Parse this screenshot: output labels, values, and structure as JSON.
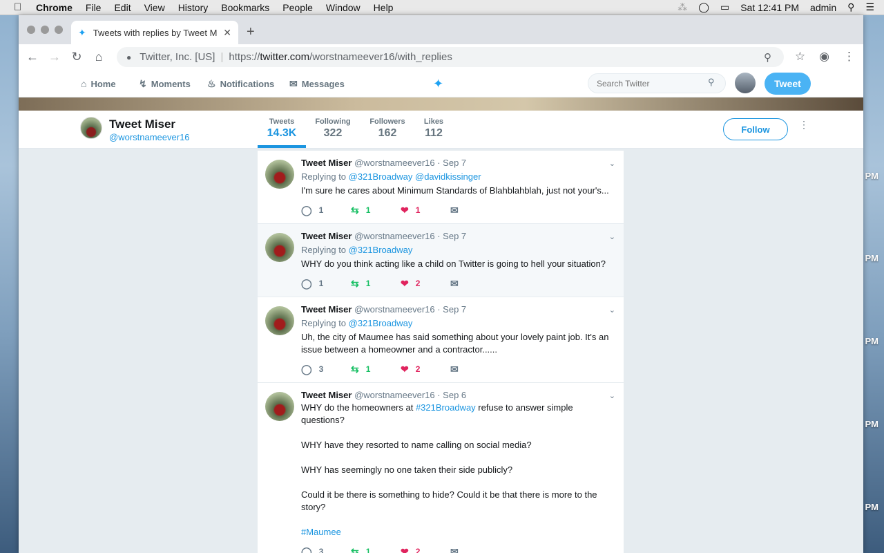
{
  "menubar": {
    "app": "Chrome",
    "items": [
      "File",
      "Edit",
      "View",
      "History",
      "Bookmarks",
      "People",
      "Window",
      "Help"
    ],
    "clock": "Sat 12:41 PM",
    "user": "admin"
  },
  "desktop": {
    "pm_labels": [
      "PM",
      "PM",
      "PM",
      "PM",
      "PM"
    ]
  },
  "browser": {
    "tab_title": "Tweets with replies by Tweet M",
    "org": "Twitter, Inc. [US]",
    "url_prefix": "https://",
    "url_host": "twitter.com",
    "url_path": "/worstnameever16/with_replies"
  },
  "twitter_nav": {
    "home": "Home",
    "moments": "Moments",
    "notifications": "Notifications",
    "messages": "Messages",
    "search_placeholder": "Search Twitter",
    "tweet_button": "Tweet"
  },
  "profile": {
    "name": "Tweet Miser",
    "handle": "@worstnameever16",
    "stats": [
      {
        "label": "Tweets",
        "value": "14.3K"
      },
      {
        "label": "Following",
        "value": "322"
      },
      {
        "label": "Followers",
        "value": "162"
      },
      {
        "label": "Likes",
        "value": "112"
      }
    ],
    "follow_label": "Follow"
  },
  "tweets": [
    {
      "name": "Tweet Miser",
      "handle": "@worstnameever16",
      "date": "· Sep 7",
      "replying_prefix": "Replying to",
      "reply_to_1": "@321Broadway",
      "reply_to_2": "@davidkissinger",
      "text": "I'm sure he cares about Minimum Standards of Blahblahblah, just not your's...",
      "replies": "1",
      "retweets": "1",
      "likes": "1"
    },
    {
      "name": "Tweet Miser",
      "handle": "@worstnameever16",
      "date": "· Sep 7",
      "replying_prefix": "Replying to",
      "reply_to_1": "@321Broadway",
      "text": "WHY do you think acting like a child on Twitter is going to hell your situation?",
      "replies": "1",
      "retweets": "1",
      "likes": "2"
    },
    {
      "name": "Tweet Miser",
      "handle": "@worstnameever16",
      "date": "· Sep 7",
      "replying_prefix": "Replying to",
      "reply_to_1": "@321Broadway",
      "text": "Uh, the city of Maumee has said something about your lovely paint job. It's an issue between a homeowner and a contractor......",
      "replies": "3",
      "retweets": "1",
      "likes": "2"
    },
    {
      "name": "Tweet Miser",
      "handle": "@worstnameever16",
      "date": "· Sep 6",
      "text_before_tag": "WHY do the homeowners at ",
      "hashtag_1": "#321Broadway",
      "text_after_tag": " refuse to answer simple questions?\n\nWHY have they resorted to name calling on social media?\n\nWHY has seemingly no one taken their side publicly?\n\nCould it be there is something to hide? Could it be that there is more to the story?\n\n",
      "hashtag_2": "#Maumee",
      "replies": "3",
      "retweets": "1",
      "likes": "2"
    }
  ]
}
